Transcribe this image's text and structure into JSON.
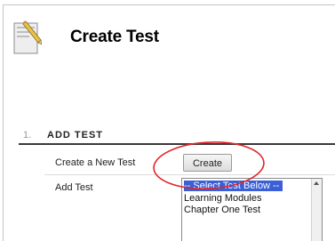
{
  "header": {
    "title": "Create Test",
    "icon": "test-pencil-icon"
  },
  "section": {
    "step_number": "1.",
    "title": "ADD TEST"
  },
  "create_row": {
    "label": "Create a New Test",
    "button_label": "Create"
  },
  "add_row": {
    "label": "Add Test",
    "options": [
      "-- Select Test Below --",
      "Learning Modules",
      "Chapter One Test"
    ],
    "selected_index": 0
  },
  "colors": {
    "selection": "#3a5fd6",
    "annotation": "#e0242a",
    "section_rule": "#3a3a3a"
  }
}
